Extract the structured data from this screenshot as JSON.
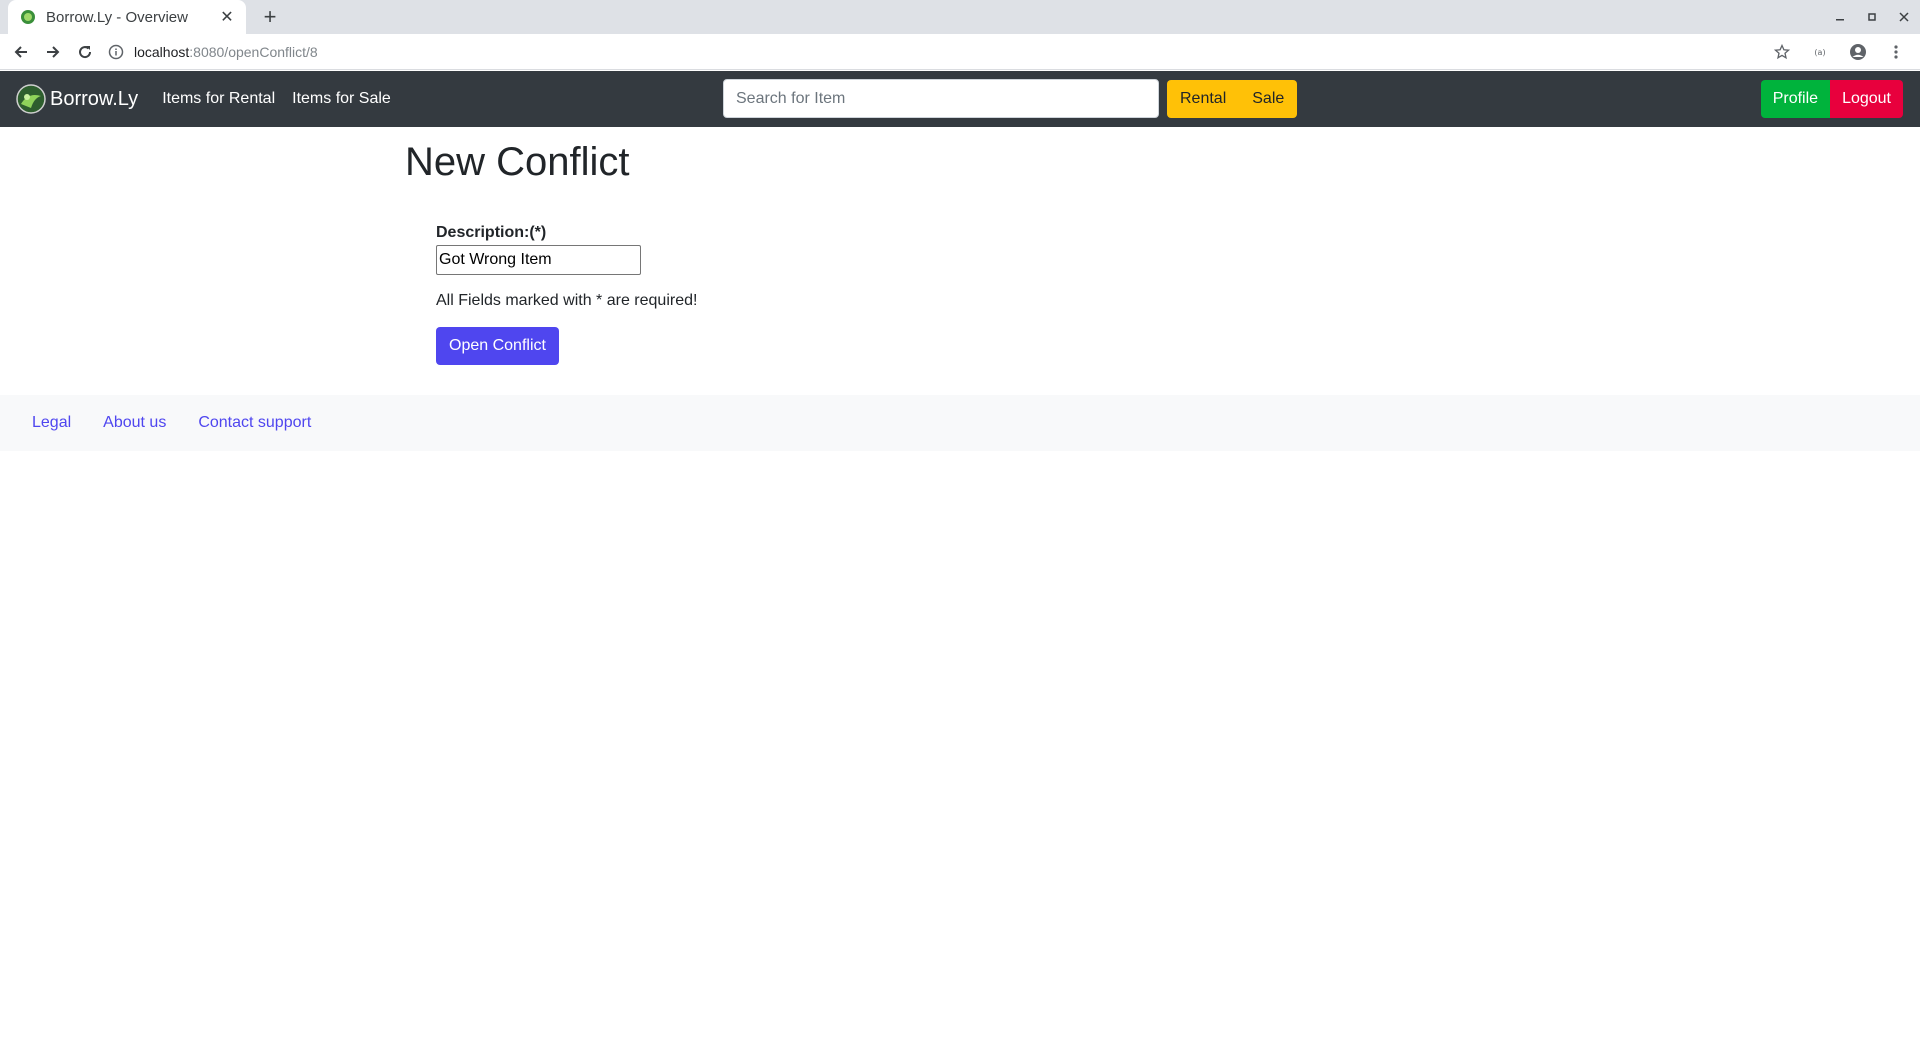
{
  "browser": {
    "tab_title": "Borrow.Ly - Overview",
    "url_host": "localhost",
    "url_path": ":8080/openConflict/8"
  },
  "navbar": {
    "brand": "Borrow.Ly",
    "links": [
      "Items for Rental",
      "Items for Sale"
    ],
    "search_placeholder": "Search for Item",
    "rental_button": "Rental",
    "sale_button": "Sale",
    "profile_button": "Profile",
    "logout_button": "Logout"
  },
  "main": {
    "title": "New Conflict",
    "description_label": "Description:(*)",
    "description_value": "Got Wrong Item",
    "required_note": "All Fields marked with * are required!",
    "submit_button": "Open Conflict"
  },
  "footer": {
    "links": [
      "Legal",
      "About us",
      "Contact support"
    ]
  },
  "colors": {
    "navbar_bg": "#343a40",
    "warning": "#ffc107",
    "success": "#00b33c",
    "danger": "#e8003d",
    "primary": "#4f46ef"
  }
}
